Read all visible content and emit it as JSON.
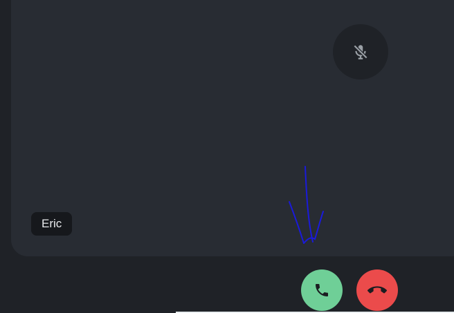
{
  "participant": {
    "name": "Eric",
    "muted": true
  },
  "icons": {
    "mute": "microphone-off-icon",
    "accept": "phone-icon",
    "decline": "phone-hangup-icon"
  },
  "colors": {
    "background": "#1f2227",
    "tile": "#282c33",
    "accept": "#6fcf97",
    "decline": "#eb4b4b",
    "annotation": "#1a1adb"
  }
}
